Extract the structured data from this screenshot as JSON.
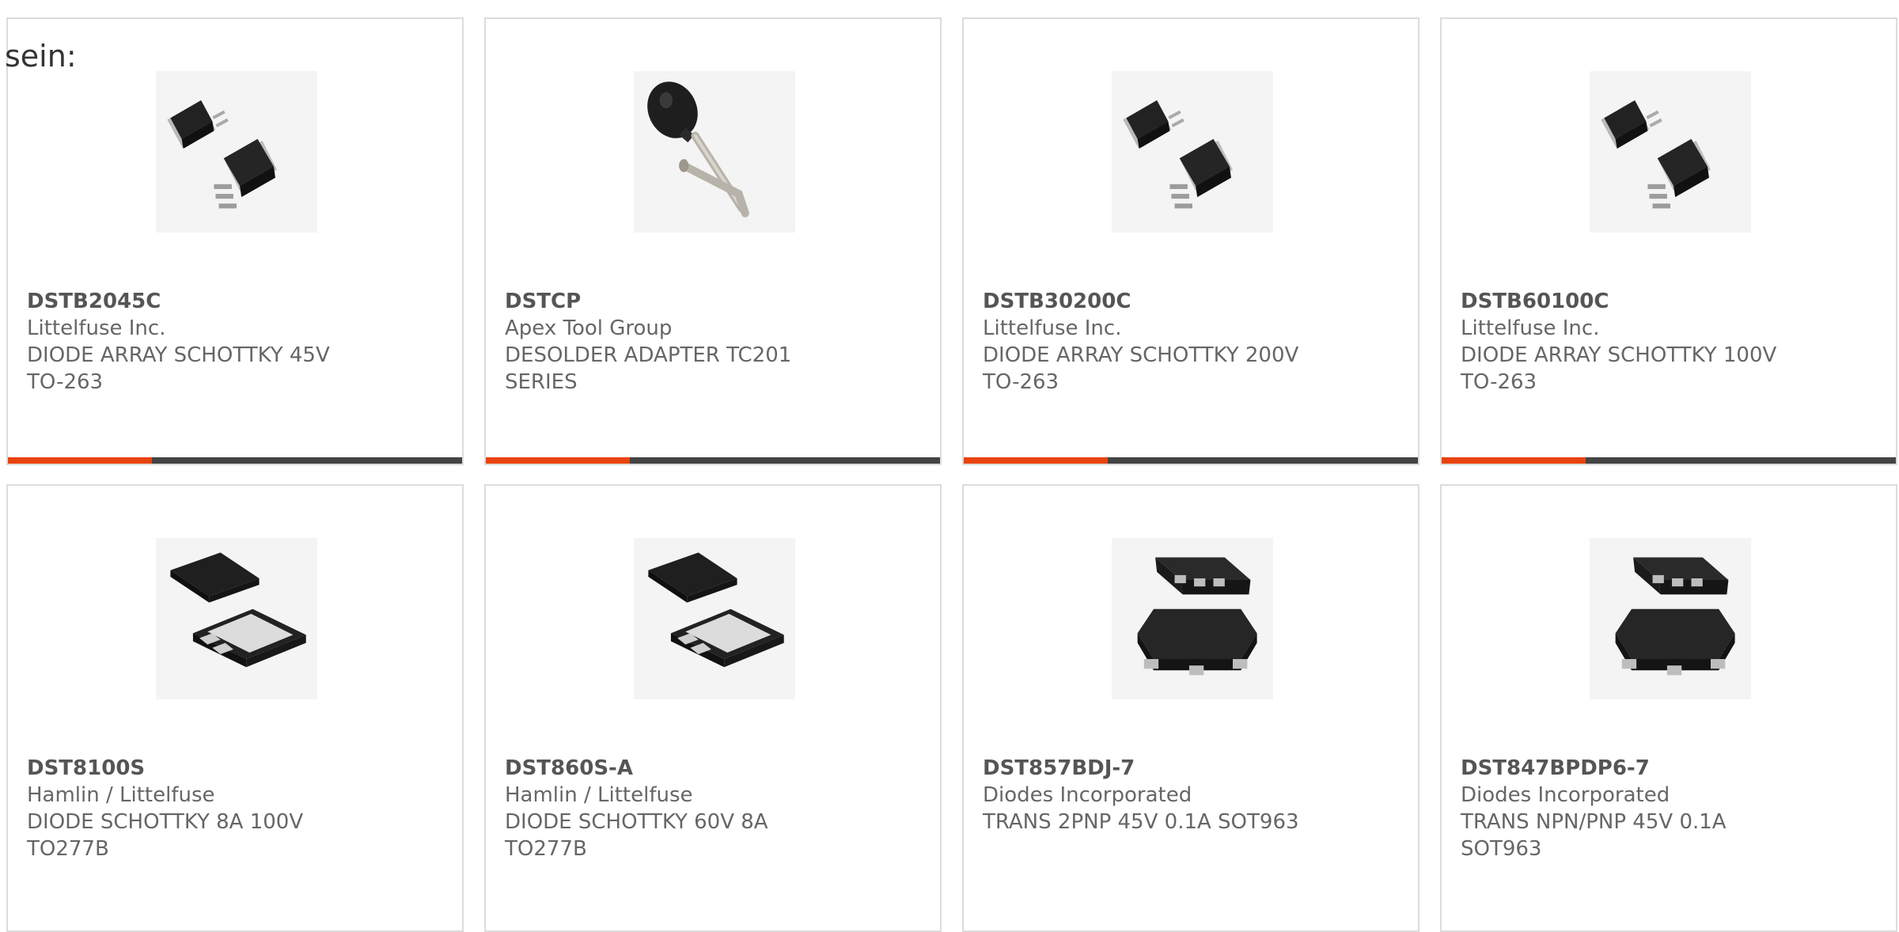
{
  "heading": "sein:",
  "products": [
    {
      "part_number": "DSTB2045C",
      "manufacturer": "Littelfuse Inc.",
      "description": "DIODE ARRAY SCHOTTKY 45V TO-263",
      "image": "to263-package"
    },
    {
      "part_number": "DSTCP",
      "manufacturer": "Apex Tool Group",
      "description": "DESOLDER ADAPTER TC201 SERIES",
      "image": "desolder-bulb"
    },
    {
      "part_number": "DSTB30200C",
      "manufacturer": "Littelfuse Inc.",
      "description": "DIODE ARRAY SCHOTTKY 200V TO-263",
      "image": "to263-package"
    },
    {
      "part_number": "DSTB60100C",
      "manufacturer": "Littelfuse Inc.",
      "description": "DIODE ARRAY SCHOTTKY 100V TO-263",
      "image": "to263-package"
    },
    {
      "part_number": "DST8100S",
      "manufacturer": "Hamlin / Littelfuse",
      "description": "DIODE SCHOTTKY 8A 100V TO277B",
      "image": "to277b-package"
    },
    {
      "part_number": "DST860S-A",
      "manufacturer": "Hamlin / Littelfuse",
      "description": "DIODE SCHOTTKY 60V 8A TO277B",
      "image": "to277b-package"
    },
    {
      "part_number": "DST857BDJ-7",
      "manufacturer": "Diodes Incorporated",
      "description": "TRANS 2PNP 45V 0.1A SOT963",
      "image": "sot963-package"
    },
    {
      "part_number": "DST847BPDP6-7",
      "manufacturer": "Diodes Incorporated",
      "description": "TRANS NPN/PNP 45V 0.1A SOT963",
      "image": "sot963-package"
    }
  ],
  "colors": {
    "accent": "#e8430f",
    "bar": "#444444",
    "border": "#dcdcdc"
  }
}
